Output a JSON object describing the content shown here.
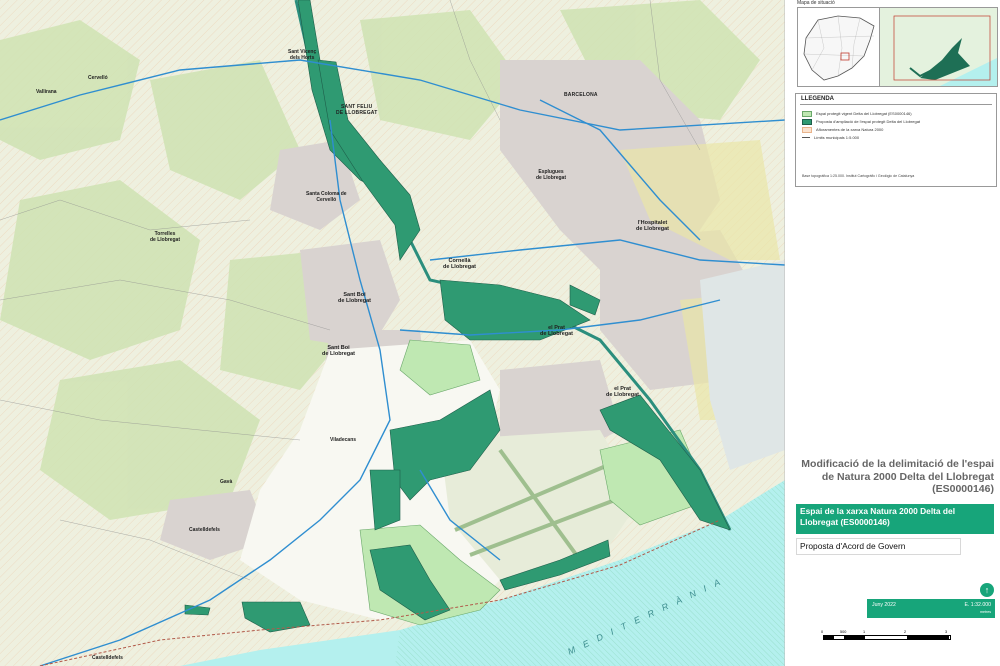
{
  "map": {
    "places": [
      {
        "name": "Sant Vicenç\ndels Horts"
      },
      {
        "name": "SANT FELIU\nDE LLOBREGAT"
      },
      {
        "name": "Santa Coloma de\nCervelló"
      },
      {
        "name": "Cornellà\nde Llobregat"
      },
      {
        "name": "Sant Boi\nde Llobregat"
      },
      {
        "name": "Sant Boi\nde Llobregat"
      },
      {
        "name": "el Prat\nde Llobregat"
      },
      {
        "name": "el Prat\nde Llobregat"
      },
      {
        "name": "l'Hospitalet\nde Llobregat"
      },
      {
        "name": "Esplugues\nde Llobregat"
      },
      {
        "name": "BARCELONA"
      },
      {
        "name": "Viladecans"
      },
      {
        "name": "Castelldefels"
      },
      {
        "name": "Gavà"
      },
      {
        "name": "Torrelles\nde Llobregat"
      },
      {
        "name": "Cervelló"
      },
      {
        "name": "Vallirana"
      },
      {
        "name": "Castelldefels"
      }
    ],
    "sea_label": "MEDITERRÀNIA",
    "colors": {
      "protected_existing": "#2f9a72",
      "proposed_extension": "#bfe8b2",
      "sea": "#b4f0ee",
      "urban": "#d9d3d0",
      "roads": "#2f8ed0"
    }
  },
  "panel": {
    "situation_title": "Mapa de situació",
    "legend": {
      "title": "LLEGENDA",
      "items": [
        {
          "label": "Espai protegit vigent Delta del Llobregat (ES0000146)"
        },
        {
          "label": "Proposta d'ampliació de l'espai protegit Delta del Llobregat"
        },
        {
          "label": "Afloramentes de la xarxa Natura 2000"
        },
        {
          "label": "Límits municipals 1:5.000"
        }
      ],
      "footnote": "Base topogràfica 1:25.000. Institut Cartogràfic i Geològic de Catalunya"
    },
    "main_title": "Modificació de la delimitació de l'espai de Natura 2000 Delta del Llobregat (ES0000146)",
    "network_title": "Espai de la xarxa Natura 2000 Delta del Llobregat (ES0000146)",
    "proposal": "Proposta d'Acord de Govern",
    "date": "Juny 2022",
    "scale": "E. 1:32.000",
    "units": "metres",
    "scale_ticks": [
      "0",
      "500",
      "1",
      "2",
      "3"
    ]
  }
}
